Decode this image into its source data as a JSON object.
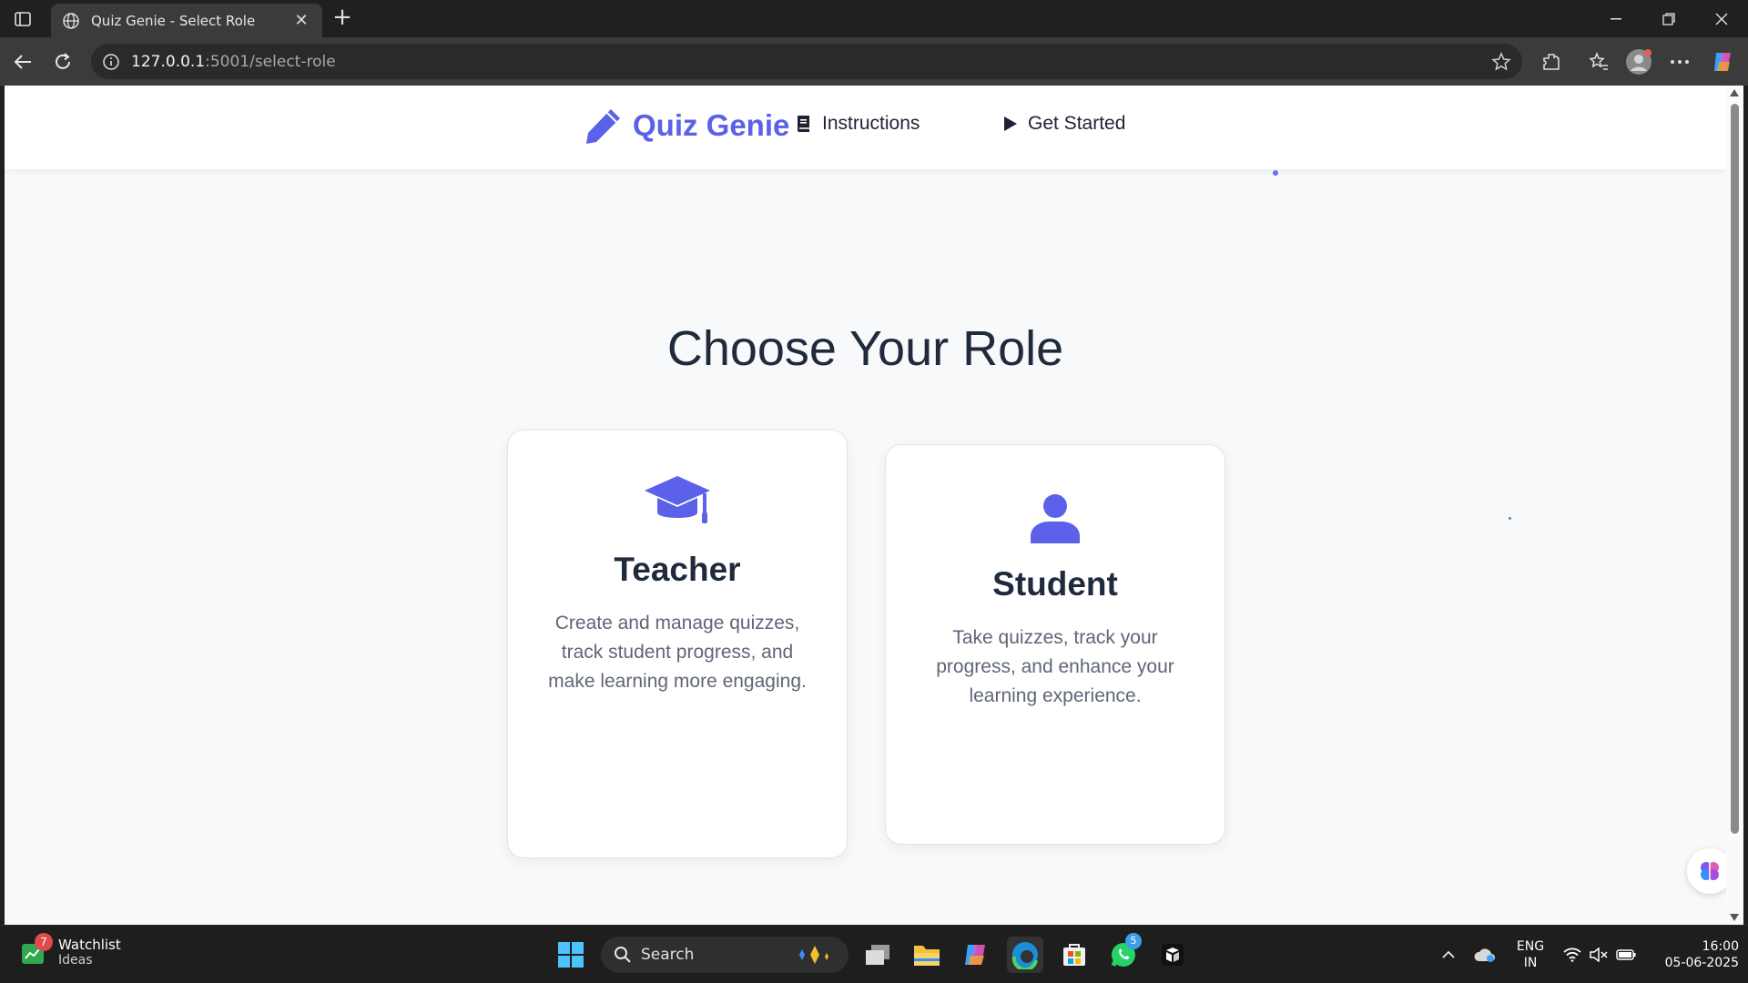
{
  "browser": {
    "tab_title": "Quiz Genie - Select Role",
    "url_host": "127.0.0.1",
    "url_rest": ":5001/select-role"
  },
  "navbar": {
    "brand": "Quiz Genie",
    "links": [
      {
        "label": "Instructions",
        "icon": "book-icon"
      },
      {
        "label": "Get Started",
        "icon": "play-icon"
      }
    ]
  },
  "main": {
    "title": "Choose Your Role",
    "cards": [
      {
        "title": "Teacher",
        "description": "Create and manage quizzes, track student progress, and make learning more engaging.",
        "icon": "graduation-cap-icon"
      },
      {
        "title": "Student",
        "description": "Take quizzes, track your progress, and enhance your learning experience.",
        "icon": "user-icon"
      }
    ]
  },
  "taskbar": {
    "widget_title": "Watchlist",
    "widget_subtitle": "Ideas",
    "widget_badge": "7",
    "search_label": "Search",
    "whatsapp_badge": "5",
    "lang_line1": "ENG",
    "lang_line2": "IN",
    "time": "16:00",
    "date": "05-06-2025"
  },
  "colors": {
    "accent": "#5b61e8",
    "heading": "#1f2a3c",
    "body_text": "#5f6678",
    "page_bg": "#f8f9fb"
  }
}
